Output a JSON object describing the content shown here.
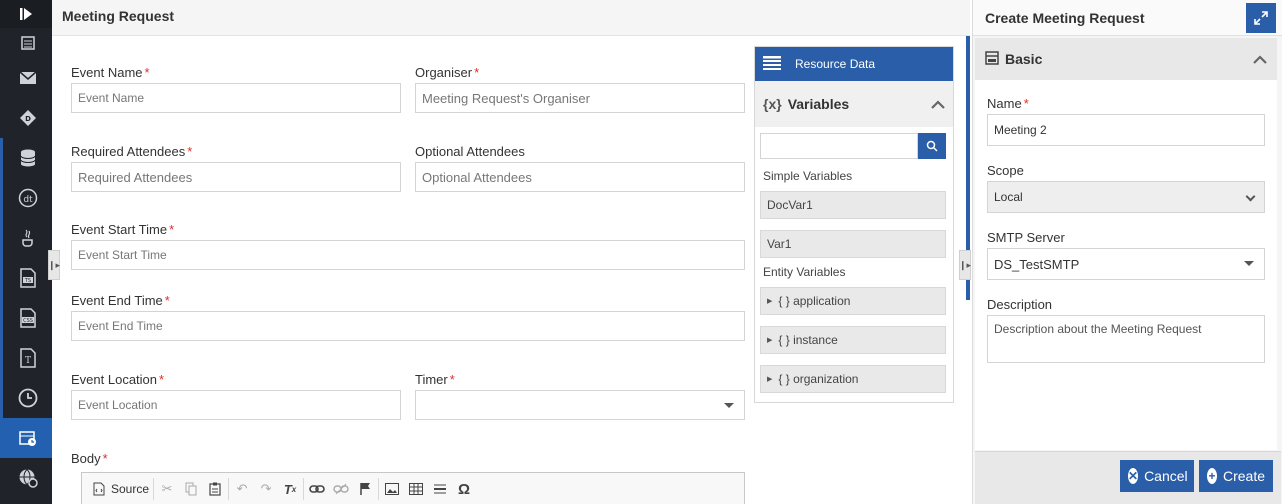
{
  "rail": {
    "icons": [
      "collapse-toggle-icon",
      "document-list-icon",
      "mail-icon",
      "gateway-icon",
      "database-icon",
      "dt-icon",
      "java-icon",
      "ts-file-icon",
      "css-file-icon",
      "text-file-icon",
      "clock-icon",
      "meeting-request-icon",
      "globe-settings-icon"
    ]
  },
  "main": {
    "title": "Meeting Request",
    "fields": {
      "event_name": {
        "label": "Event Name",
        "placeholder": "Event Name"
      },
      "organiser": {
        "label": "Organiser",
        "placeholder": "Meeting Request's Organiser"
      },
      "required_attendees": {
        "label": "Required Attendees",
        "placeholder": "Required Attendees"
      },
      "optional_attendees": {
        "label": "Optional Attendees",
        "placeholder": "Optional Attendees"
      },
      "event_start_time": {
        "label": "Event Start Time",
        "placeholder": "Event Start Time"
      },
      "event_end_time": {
        "label": "Event End Time",
        "placeholder": "Event End Time"
      },
      "event_location": {
        "label": "Event Location",
        "placeholder": "Event Location"
      },
      "timer": {
        "label": "Timer",
        "value": ""
      },
      "body": {
        "label": "Body"
      }
    },
    "required_marker": "*",
    "toolbar": {
      "source_label": "Source"
    }
  },
  "resource": {
    "title": "Resource Data",
    "variables_title": "Variables",
    "variables_icon": "{x}",
    "simple_label": "Simple Variables",
    "simple_items": [
      "DocVar1",
      "Var1"
    ],
    "entity_label": "Entity Variables",
    "entity_items": [
      "{ } application",
      "{ } instance",
      "{ } organization"
    ]
  },
  "right": {
    "title": "Create Meeting Request",
    "section": "Basic",
    "name_label": "Name",
    "name_value": "Meeting 2",
    "scope_label": "Scope",
    "scope_value": "Local",
    "smtp_label": "SMTP Server",
    "smtp_value": "DS_TestSMTP",
    "description_label": "Description",
    "description_placeholder": "Description about the Meeting Request",
    "cancel_label": "Cancel",
    "create_label": "Create"
  },
  "colors": {
    "accent": "#2a5ea8",
    "rail": "#20242a",
    "required": "#d9302c"
  }
}
